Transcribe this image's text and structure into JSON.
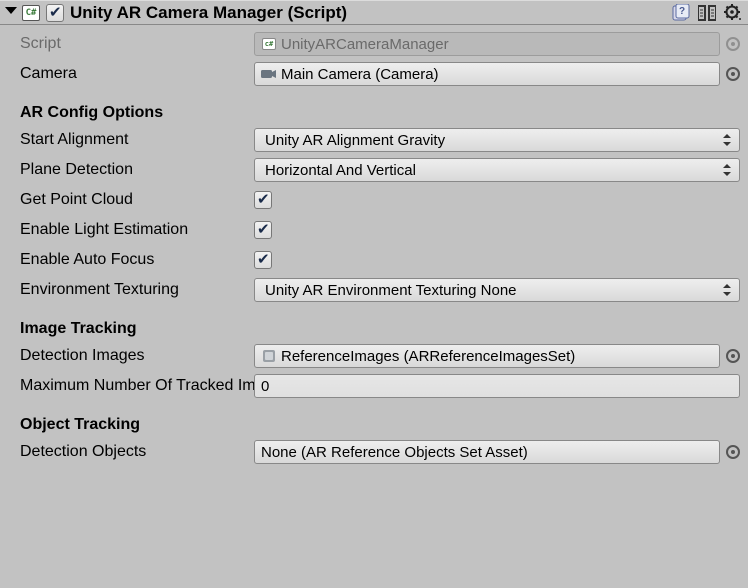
{
  "header": {
    "title": "Unity AR Camera Manager (Script)",
    "enabled": true
  },
  "fields": {
    "script": {
      "label": "Script",
      "value": "UnityARCameraManager"
    },
    "camera": {
      "label": "Camera",
      "value": "Main Camera (Camera)"
    }
  },
  "sections": {
    "arconfig": {
      "title": "AR Config Options"
    },
    "imagetrack": {
      "title": "Image Tracking"
    },
    "objecttrack": {
      "title": "Object Tracking"
    }
  },
  "arconfig": {
    "start_alignment": {
      "label": "Start Alignment",
      "value": "Unity AR Alignment Gravity"
    },
    "plane_detection": {
      "label": "Plane Detection",
      "value": "Horizontal And Vertical"
    },
    "get_point_cloud": {
      "label": "Get Point Cloud",
      "value": true
    },
    "light_estimation": {
      "label": "Enable Light Estimation",
      "value": true
    },
    "auto_focus": {
      "label": "Enable Auto Focus",
      "value": true
    },
    "env_texturing": {
      "label": "Environment Texturing",
      "value": "Unity AR Environment Texturing None"
    }
  },
  "imagetrack": {
    "detection_images": {
      "label": "Detection Images",
      "value": "ReferenceImages (ARReferenceImagesSet)"
    },
    "max_tracked": {
      "label": "Maximum Number Of Tracked Images",
      "value": "0"
    }
  },
  "objecttrack": {
    "detection_objects": {
      "label": "Detection Objects",
      "value": "None (AR Reference Objects Set Asset)"
    }
  }
}
